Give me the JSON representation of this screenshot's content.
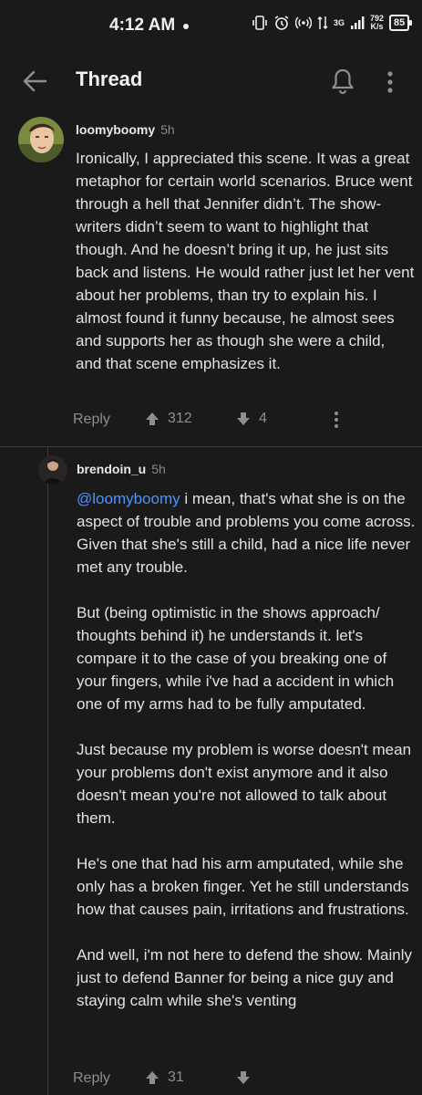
{
  "status": {
    "time": "4:12 AM",
    "network_type": "3G",
    "data_speed_value": "792",
    "data_speed_unit": "K/s",
    "battery": "85"
  },
  "appbar": {
    "title": "Thread"
  },
  "comments": [
    {
      "author": "loomyboomy",
      "age": "5h",
      "text": "Ironically, I appreciated this scene. It was a great metaphor for certain world scenarios. Bruce went through a hell that Jennifer didn’t. The show-writers didn’t seem to want to highlight that though. And he doesn’t bring it up, he just sits back and listens. He would rather just let her vent about her problems, than try to explain his. I almost found it funny because, he almost sees and supports her as though she were a child, and that scene emphasizes it.",
      "reply_label": "Reply",
      "upvotes": "312",
      "downvotes": "4"
    },
    {
      "author": "brendoin_u",
      "age": "5h",
      "mention": "@loomyboomy",
      "text": " i mean, that's what she is on the aspect of trouble and problems you come across. Given that she's still a child, had a nice life never met any trouble.\n\nBut (being optimistic in the shows approach/ thoughts behind it) he understands it. let's compare it to the case of you breaking one of your fingers, while i've had a accident in which one of my arms had to be fully amputated.\n\nJust because my problem is worse doesn't mean your problems don't exist anymore and it also doesn't mean you're not allowed to talk about them.\n\nHe's one that had his arm amputated, while she only has a broken finger. Yet he still understands how that causes pain, irritations and frustrations.\n\nAnd well, i'm not here to defend the show. Mainly just to defend Banner for being a nice guy and staying calm while she's venting",
      "reply_label": "Reply",
      "upvotes": "31",
      "downvotes": ""
    }
  ],
  "colors": {
    "background": "#1a1a1a",
    "mention": "#4f93ff",
    "muted": "#8e8e8e"
  }
}
